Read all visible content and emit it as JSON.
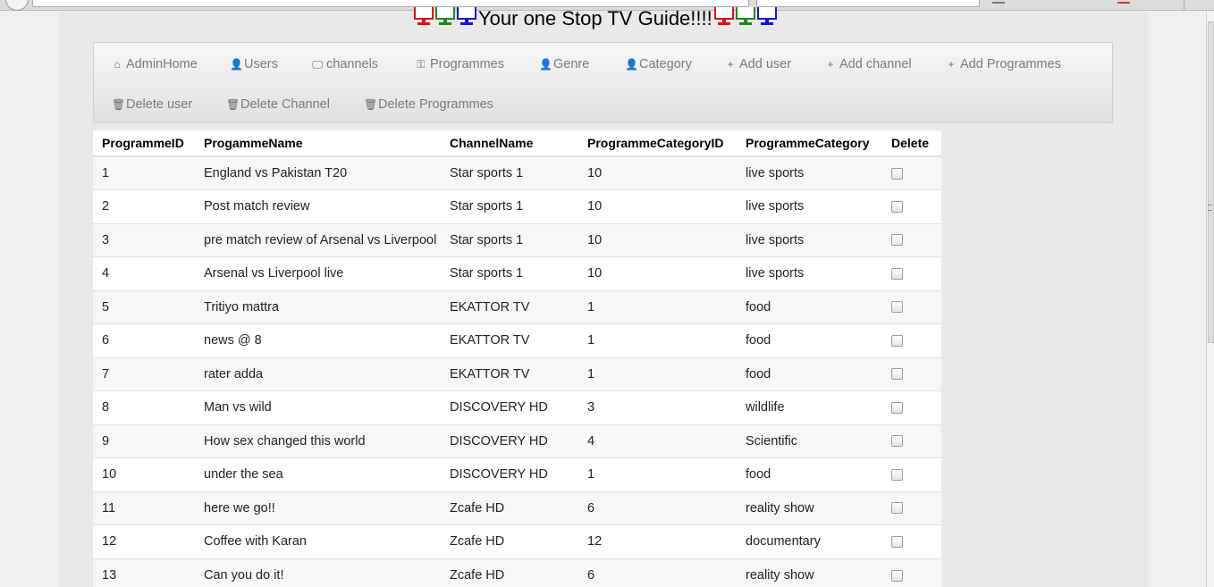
{
  "page": {
    "title": "Your one Stop TV Guide!!!!",
    "tv_colors": [
      "#e01010",
      "#1c8a1c",
      "#1414d6"
    ]
  },
  "nav": {
    "items": [
      {
        "label": "AdminHome",
        "icon": "home-icon",
        "glyph": "⌂"
      },
      {
        "label": "Users",
        "icon": "user-icon",
        "glyph": "👤"
      },
      {
        "label": "channels",
        "icon": "monitor-icon",
        "glyph": "🖵"
      },
      {
        "label": "Programmes",
        "icon": "key-icon",
        "glyph": "⚿"
      },
      {
        "label": "Genre",
        "icon": "user-icon",
        "glyph": "👤"
      },
      {
        "label": "Category",
        "icon": "user-icon",
        "glyph": "👤"
      },
      {
        "label": "Add user",
        "icon": "plus-icon",
        "glyph": "+"
      },
      {
        "label": "Add channel",
        "icon": "plus-icon",
        "glyph": "+"
      },
      {
        "label": "Add Programmes",
        "icon": "plus-icon",
        "glyph": "+"
      },
      {
        "label": "Delete user",
        "icon": "trash-icon",
        "glyph": "🗑"
      },
      {
        "label": "Delete Channel",
        "icon": "trash-icon",
        "glyph": "🗑"
      },
      {
        "label": "Delete Programmes",
        "icon": "trash-icon",
        "glyph": "🗑"
      }
    ]
  },
  "table": {
    "headers": [
      "ProgrammeID",
      "ProgammeName",
      "ChannelName",
      "ProgrammeCategoryID",
      "ProgrammeCategory",
      "Delete"
    ],
    "rows": [
      {
        "id": "1",
        "name": "England vs Pakistan T20",
        "channel": "Star sports 1",
        "cat_id": "10",
        "category": "live sports",
        "checked": false
      },
      {
        "id": "2",
        "name": "Post match review",
        "channel": "Star sports 1",
        "cat_id": "10",
        "category": "live sports",
        "checked": false
      },
      {
        "id": "3",
        "name": "pre match review of Arsenal vs Liverpool",
        "channel": "Star sports 1",
        "cat_id": "10",
        "category": "live sports",
        "checked": false
      },
      {
        "id": "4",
        "name": "Arsenal vs Liverpool live",
        "channel": "Star sports 1",
        "cat_id": "10",
        "category": "live sports",
        "checked": false
      },
      {
        "id": "5",
        "name": "Tritiyo mattra",
        "channel": "EKATTOR TV",
        "cat_id": "1",
        "category": "food",
        "checked": false
      },
      {
        "id": "6",
        "name": "news @ 8",
        "channel": "EKATTOR TV",
        "cat_id": "1",
        "category": "food",
        "checked": false
      },
      {
        "id": "7",
        "name": "rater adda",
        "channel": "EKATTOR TV",
        "cat_id": "1",
        "category": "food",
        "checked": false
      },
      {
        "id": "8",
        "name": "Man vs wild",
        "channel": "DISCOVERY HD",
        "cat_id": "3",
        "category": "wildlife",
        "checked": false
      },
      {
        "id": "9",
        "name": "How sex changed this world",
        "channel": "DISCOVERY HD",
        "cat_id": "4",
        "category": "Scientific",
        "checked": false
      },
      {
        "id": "10",
        "name": "under the sea",
        "channel": "DISCOVERY HD",
        "cat_id": "1",
        "category": "food",
        "checked": false
      },
      {
        "id": "11",
        "name": "here we go!!",
        "channel": "Zcafe HD",
        "cat_id": "6",
        "category": "reality show",
        "checked": false
      },
      {
        "id": "12",
        "name": "Coffee with Karan",
        "channel": "Zcafe HD",
        "cat_id": "12",
        "category": "documentary",
        "checked": false
      },
      {
        "id": "13",
        "name": "Can you do it!",
        "channel": "Zcafe HD",
        "cat_id": "6",
        "category": "reality show",
        "checked": false
      }
    ]
  }
}
